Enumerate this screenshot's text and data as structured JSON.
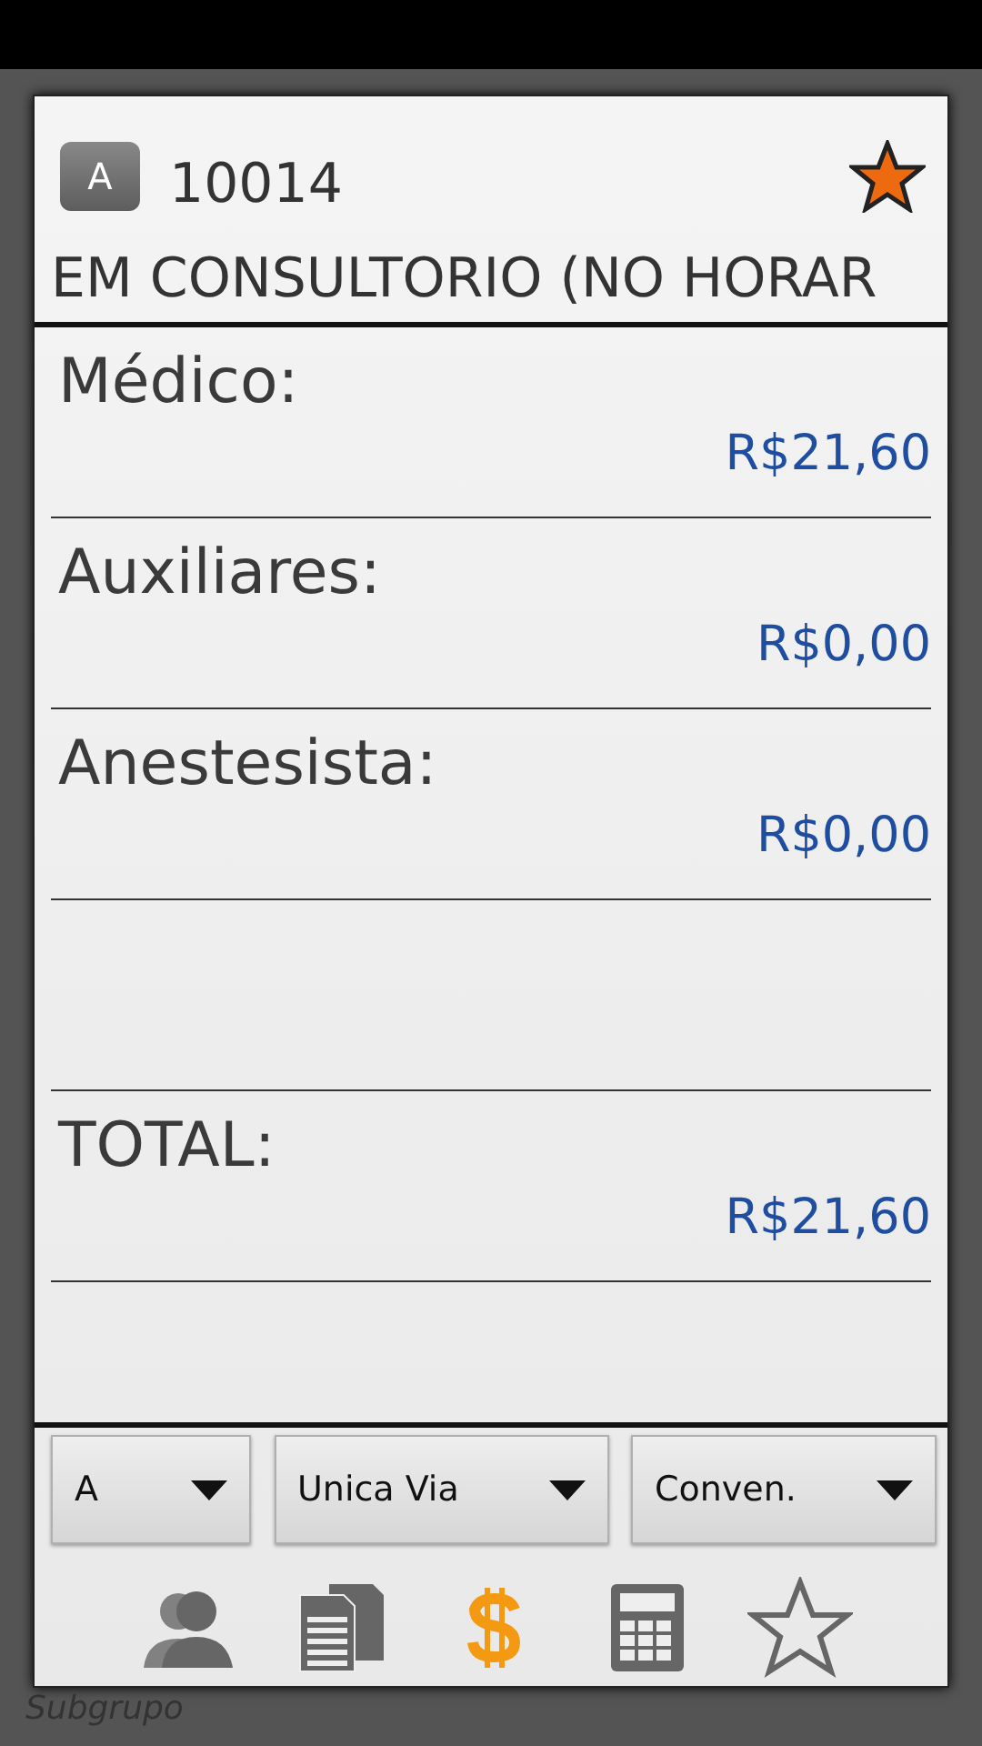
{
  "background_label": "Subgrupo",
  "dialog": {
    "badge": "A",
    "code": "10014",
    "starred": true,
    "subtitle": "EM CONSULTORIO (NO HORAR",
    "rows": [
      {
        "kind": "amount",
        "label": "Médico:",
        "value": "R$21,60"
      },
      {
        "kind": "amount",
        "label": "Auxiliares:",
        "value": "R$0,00"
      },
      {
        "kind": "amount",
        "label": "Anestesista:",
        "value": "R$0,00"
      },
      {
        "kind": "blank"
      },
      {
        "kind": "amount",
        "label": "TOTAL:",
        "value": "R$21,60"
      }
    ],
    "dropdowns": [
      "A",
      "Unica Via",
      "Conven."
    ],
    "tabs": [
      {
        "kind": "people",
        "selected": false
      },
      {
        "kind": "documents",
        "selected": false
      },
      {
        "kind": "money",
        "selected": true
      },
      {
        "kind": "calculator",
        "selected": false
      },
      {
        "kind": "star",
        "selected": false
      }
    ]
  }
}
